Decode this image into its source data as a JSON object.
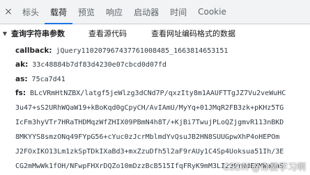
{
  "tabs": {
    "close_symbol": "×",
    "items": [
      "标头",
      "载荷",
      "预览",
      "响应",
      "启动器",
      "时间",
      "Cookie"
    ],
    "active": "载荷"
  },
  "query_section": {
    "title": "查询字符串参数",
    "view_source": "查看源代码",
    "view_url_encoded": "查看网址编码格式的数据",
    "params": [
      {
        "key": "callback:",
        "value": "jQuery110207967437761008485_1663814653151"
      },
      {
        "key": "ak:",
        "value": "33c48884b7df83d4230e07cbcd0d07fd"
      },
      {
        "key": "as:",
        "value": "75ca7d41"
      },
      {
        "key": "fs:",
        "value": "BLcVRmHtNZBX/latgf5jeWlzg3dCNd7P/qxzIty8m1AAUFTTgJZ7Vu2veWuHC"
      }
    ],
    "continuation": [
      "3u47+sS2URhWQaW19+kBoKqd0gCpyCH/AvIAmU/MyYq+01JMqR2FB3zk+pKHz5TG",
      "IcFm3hyVTr7HRaTHDMqzWfZHIX09PBmN4h8T/+KjBi7TwujPLoQZjgmvR113nBKD",
      "8MKYYS8smzONq49FYpG56+cYuc0zJcrMblmdYvQsuJB2HN8SUUGpwXhP4oHEPOm",
      "J2FOxIKO13Lm1zkSpTDkIXaBd3+mxZzuDfh5l2aF9rAUy1C4Sp4Uoksua51Ih/3E",
      "CG2mMwWk1fOH/NFwpFHXrDQZo10mDzzBcB515IfqFRyK9mM3LI299rNdEXMWaXaS"
    ]
  },
  "watermark": "CSDN @你要学习啊"
}
